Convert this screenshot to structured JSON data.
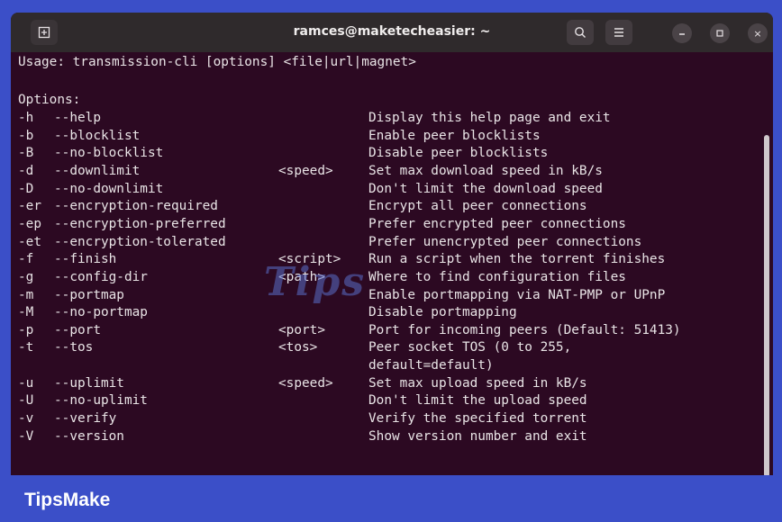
{
  "window": {
    "title": "ramces@maketecheasier: ~"
  },
  "titlebar": {
    "icons": [
      "new-tab-icon",
      "search-icon",
      "menu-icon",
      "minimize-icon",
      "maximize-icon",
      "close-icon"
    ],
    "close_glyph": "×"
  },
  "terminal": {
    "usage": "Usage: transmission-cli [options] <file|url|magnet>",
    "options_header": "Options:",
    "options": [
      {
        "short": "-h",
        "long": "--help",
        "arg": "",
        "desc": "Display this help page and exit"
      },
      {
        "short": "-b",
        "long": "--blocklist",
        "arg": "",
        "desc": "Enable peer blocklists"
      },
      {
        "short": "-B",
        "long": "--no-blocklist",
        "arg": "",
        "desc": "Disable peer blocklists"
      },
      {
        "short": "-d",
        "long": "--downlimit",
        "arg": "<speed>",
        "desc": "Set max download speed in kB/s"
      },
      {
        "short": "-D",
        "long": "--no-downlimit",
        "arg": "",
        "desc": "Don't limit the download speed"
      },
      {
        "short": "-er",
        "long": "--encryption-required",
        "arg": "",
        "desc": "Encrypt all peer connections"
      },
      {
        "short": "-ep",
        "long": "--encryption-preferred",
        "arg": "",
        "desc": "Prefer encrypted peer connections"
      },
      {
        "short": "-et",
        "long": "--encryption-tolerated",
        "arg": "",
        "desc": "Prefer unencrypted peer connections"
      },
      {
        "short": "-f",
        "long": "--finish",
        "arg": "<script>",
        "desc": "Run a script when the torrent finishes"
      },
      {
        "short": "-g",
        "long": "--config-dir",
        "arg": "<path>",
        "desc": "Where to find configuration files"
      },
      {
        "short": "-m",
        "long": "--portmap",
        "arg": "",
        "desc": "Enable portmapping via NAT-PMP or UPnP"
      },
      {
        "short": "-M",
        "long": "--no-portmap",
        "arg": "",
        "desc": "Disable portmapping"
      },
      {
        "short": "-p",
        "long": "--port",
        "arg": "<port>",
        "desc": "Port for incoming peers (Default: 51413)"
      },
      {
        "short": "-t",
        "long": "--tos",
        "arg": "<tos>",
        "desc": "Peer socket TOS (0 to 255,"
      },
      {
        "short": "",
        "long": "",
        "arg": "",
        "desc": "default=default)"
      },
      {
        "short": "-u",
        "long": "--uplimit",
        "arg": "<speed>",
        "desc": "Set max upload speed in kB/s"
      },
      {
        "short": "-U",
        "long": "--no-uplimit",
        "arg": "",
        "desc": "Don't limit the upload speed"
      },
      {
        "short": "-v",
        "long": "--verify",
        "arg": "",
        "desc": "Verify the specified torrent"
      },
      {
        "short": "-V",
        "long": "--version",
        "arg": "",
        "desc": "Show version number and exit"
      }
    ]
  },
  "watermark": "Tips",
  "brand": "TipsMake",
  "colors": {
    "terminal_bg": "#2c0922",
    "titlebar_bg": "#2f2a2c",
    "brand_bg": "#3b4fc8",
    "text": "#e9e4e6"
  }
}
